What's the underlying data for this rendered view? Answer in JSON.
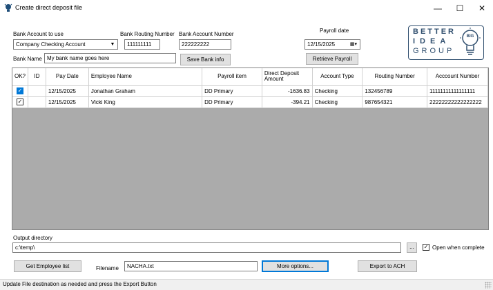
{
  "window": {
    "title": "Create direct deposit file"
  },
  "bank": {
    "account_label": "Bank Account to use",
    "account_value": "Company Checking Account",
    "routing_label": "Bank Routing Number",
    "routing_value": "111111111",
    "number_label": "Bank Account Number",
    "number_value": "222222222",
    "name_label": "Bank Name",
    "name_value": "My bank name goes here",
    "save_label": "Save Bank info"
  },
  "payroll": {
    "date_label": "Payroll date",
    "date_value": "12/15/2025",
    "retrieve_label": "Retrieve Payroll"
  },
  "logo": {
    "line1": "BETTER",
    "line2": "IDEA",
    "line3": "GROUP",
    "badge": "BIG"
  },
  "table": {
    "columns": [
      "OK?",
      "ID",
      "Pay Date",
      "Employee Name",
      "Payroll item",
      "Direct Deposit Amount",
      "Account Type",
      "Routing Number",
      "Acccount Number"
    ],
    "rows": [
      {
        "ok": true,
        "id": "",
        "pay_date": "12/15/2025",
        "employee": "Jonathan Graham",
        "item": "DD Primary",
        "amount": "-1636.83",
        "type": "Checking",
        "routing": "132456789",
        "account": "11111111111111111",
        "selected": true
      },
      {
        "ok": true,
        "id": "",
        "pay_date": "12/15/2025",
        "employee": "Vicki King",
        "item": "DD Primary",
        "amount": "-394.21",
        "type": "Checking",
        "routing": "987654321",
        "account": "22222222222222222",
        "selected": false
      }
    ]
  },
  "output": {
    "dir_label": "Output directory",
    "dir_value": "c:\\temp\\",
    "browse_label": "...",
    "open_label": "Open when complete",
    "open_checked": true
  },
  "actions": {
    "employee_list": "Get Employee list",
    "filename_label": "Filename",
    "filename_value": "NACHA.txt",
    "more_options": "More options...",
    "export": "Export to ACH"
  },
  "status": {
    "text": "Update File destination as needed and press the Export Button"
  },
  "colors": {
    "accent": "#0078d7",
    "grid_bg": "#ababab",
    "logo": "#2f4e6e"
  }
}
